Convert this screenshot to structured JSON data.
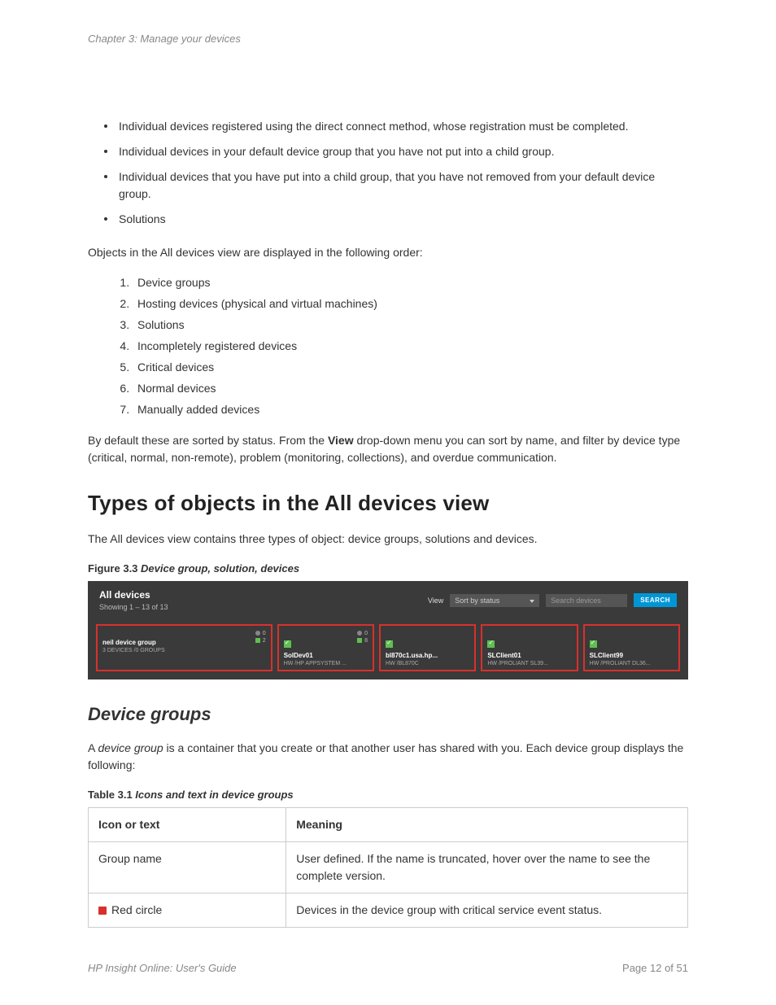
{
  "header": {
    "chapter": "Chapter 3: Manage your devices"
  },
  "bullets": [
    "Individual devices registered using the direct connect method, whose registration must be completed.",
    "Individual devices in your default device group that you have not put into a child group.",
    "Individual devices that you have put into a child group, that you have not removed from your default device group.",
    "Solutions"
  ],
  "para1": "Objects in the All devices view are displayed in the following order:",
  "ordered": [
    "Device groups",
    "Hosting devices (physical and virtual machines)",
    "Solutions",
    "Incompletely registered devices",
    "Critical devices",
    "Normal devices",
    "Manually added devices"
  ],
  "para2_pre": "By default these are sorted by status. From the ",
  "para2_bold": "View",
  "para2_post": " drop-down menu you can sort by name, and filter by device type (critical, normal, non-remote), problem (monitoring, collections), and overdue communication.",
  "h1": "Types of objects in the All devices view",
  "para3": "The All devices view contains three types of object: device groups, solutions and devices.",
  "fig_caption_b": "Figure 3.3 ",
  "fig_caption_i": "Device group, solution, devices",
  "figure": {
    "title": "All devices",
    "subtitle": "Showing 1 – 13 of 13",
    "view_label": "View",
    "sort": "Sort by status",
    "search_placeholder": "Search devices",
    "search_btn": "SEARCH",
    "cards": [
      {
        "name": "neil device group",
        "sub": "3 DEVICES /0 GROUPS",
        "badge1": "0",
        "badge2": "2",
        "wide": true,
        "check": false
      },
      {
        "name": "SolDev01",
        "sub": "HW /HP APPSYSTEM ...",
        "badge1": "0",
        "badge2": "8",
        "check": true
      },
      {
        "name": "bl870c1.usa.hp...",
        "sub": "HW /BL870C",
        "check": true
      },
      {
        "name": "SLClient01",
        "sub": "HW /PROLIANT SL39...",
        "check": true
      },
      {
        "name": "SLClient99",
        "sub": "HW /PROLIANT DL36...",
        "check": true
      }
    ]
  },
  "h2": "Device groups",
  "para4_pre": "A ",
  "para4_i": "device group",
  "para4_post": " is a container that you create or that another user has shared with you. Each device group displays the following:",
  "tbl_caption_b": "Table 3.1 ",
  "tbl_caption_i": "Icons and text in device groups",
  "table": {
    "h1": "Icon or text",
    "h2": "Meaning",
    "rows": [
      {
        "c1": "Group name",
        "c2": "User defined. If the name is truncated, hover over the name to see the complete version.",
        "icon": false
      },
      {
        "c1": "Red circle",
        "c2": "Devices in the device group with critical service event status.",
        "icon": true
      }
    ]
  },
  "footer": {
    "left": "HP Insight Online: User's Guide",
    "right": "Page 12 of 51"
  }
}
